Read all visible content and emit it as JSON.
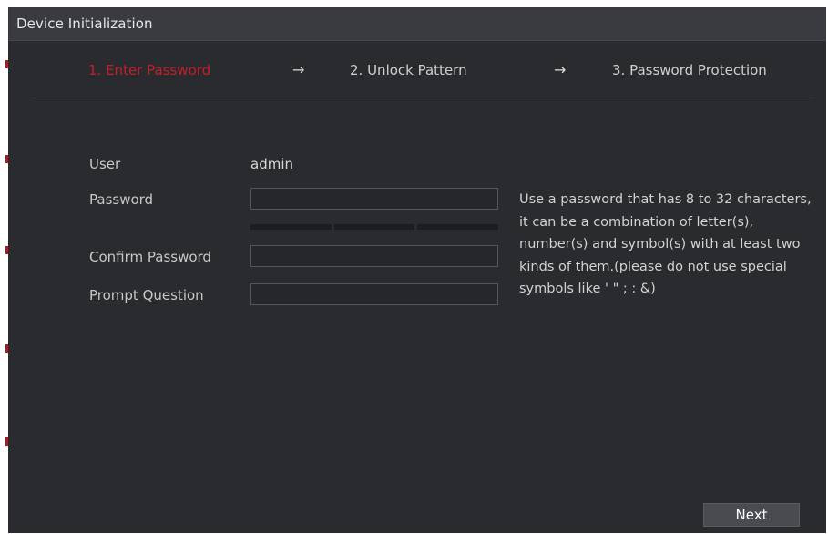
{
  "window": {
    "title": "Device Initialization"
  },
  "steps": [
    {
      "label": "1.  Enter Password",
      "active": true
    },
    {
      "label": "2.  Unlock Pattern",
      "active": false
    },
    {
      "label": "3.  Password Protection",
      "active": false
    }
  ],
  "step_arrow": "→",
  "form": {
    "user_label": "User",
    "user_value": "admin",
    "password_label": "Password",
    "password_value": "",
    "confirm_label": "Confirm Password",
    "confirm_value": "",
    "prompt_label": "Prompt Question",
    "prompt_value": ""
  },
  "hint": "Use a password that has 8 to 32 characters, it can be a combination of letter(s), number(s) and symbol(s) with at least two kinds of them.(please do not use special symbols like ' \" ; : &)",
  "buttons": {
    "next_label": "Next"
  },
  "colors": {
    "background": "#2a2b2f",
    "titlebar": "#3a3b40",
    "active_step": "#c41e2a",
    "text": "#c8c8c8"
  }
}
